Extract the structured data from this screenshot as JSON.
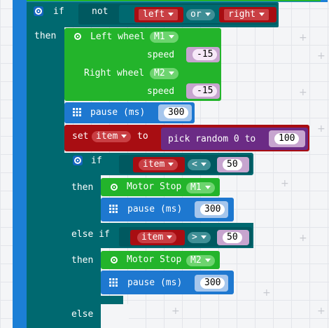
{
  "blocks": {
    "if_outer": {
      "if_label": "if",
      "not_label": "not",
      "left_dropdown": "left",
      "or_dropdown": "or",
      "right_dropdown": "right",
      "then_label": "then"
    },
    "left_wheel": {
      "label": "Left wheel",
      "motor": "M1",
      "speed_label": "speed",
      "speed_value": "-15"
    },
    "right_wheel": {
      "label": "Right wheel",
      "motor": "M2",
      "speed_label": "speed",
      "speed_value": "-15"
    },
    "pause_1": {
      "label": "pause (ms)",
      "value": "300"
    },
    "set_item": {
      "set_label": "set",
      "variable": "item",
      "to_label": "to",
      "random_label": "pick random 0 to",
      "random_max": "100"
    },
    "if_inner": {
      "if_label": "if",
      "variable": "item",
      "operator": "<",
      "value": "50",
      "then_label": "then"
    },
    "motor_stop_1": {
      "label": "Motor Stop",
      "motor": "M1"
    },
    "pause_2": {
      "label": "pause (ms)",
      "value": "300"
    },
    "else_if": {
      "label": "else if",
      "variable": "item",
      "operator": ">",
      "value": "50",
      "then_label": "then"
    },
    "motor_stop_2": {
      "label": "Motor Stop",
      "motor": "M2"
    },
    "pause_3": {
      "label": "pause (ms)",
      "value": "300"
    },
    "else_label": "else"
  },
  "colors": {
    "logic_teal": "#006970",
    "motor_green": "#23b42b",
    "basic_blue": "#1e78d0",
    "variable_red": "#a80d12",
    "math_purple": "#6b2b85",
    "workspace_bg": "#f4f5f7"
  },
  "icons": [
    "gear-icon",
    "grid-icon",
    "dropdown-arrow-icon",
    "plus-grid-marker"
  ]
}
